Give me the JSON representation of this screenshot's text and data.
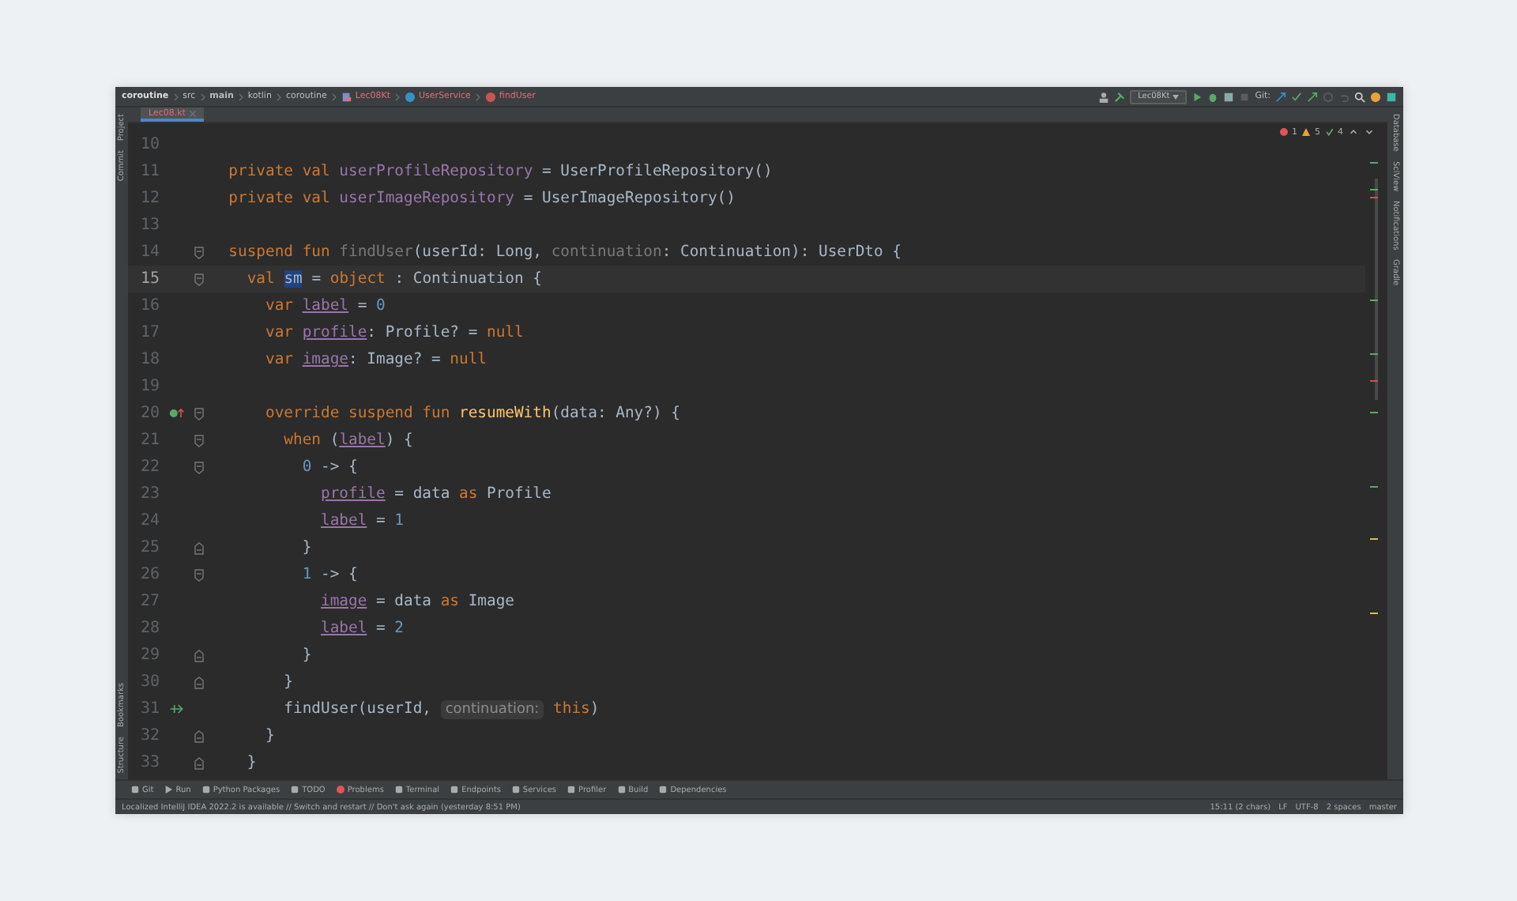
{
  "breadcrumbs": [
    {
      "label": "coroutine",
      "kind": "project"
    },
    {
      "label": "src",
      "kind": "folder"
    },
    {
      "label": "main",
      "kind": "folder"
    },
    {
      "label": "kotlin",
      "kind": "folder"
    },
    {
      "label": "coroutine",
      "kind": "folder"
    },
    {
      "label": "Lec08Kt",
      "kind": "file"
    },
    {
      "label": "UserService",
      "kind": "class"
    },
    {
      "label": "findUser",
      "kind": "method"
    }
  ],
  "toolbar": {
    "run_config": "Lec08Kt",
    "vcs_label": "Git:"
  },
  "tabs": [
    {
      "label": "Lec08.kt",
      "selected": true
    }
  ],
  "left_tools_top": [
    "Project",
    "Commit"
  ],
  "left_tools_bottom": [
    "Bookmarks",
    "Structure"
  ],
  "right_tools": [
    "Database",
    "SciView",
    "Notifications",
    "Gradle"
  ],
  "inspections": {
    "errors": "1",
    "warnings": "5",
    "weak": "4"
  },
  "lines": [
    {
      "number": "10",
      "current": false
    },
    {
      "number": "11",
      "current": false,
      "tokens": [
        {
          "kind": "keyword",
          "t": "  private val "
        },
        {
          "kind": "field",
          "t": "userProfileRepository"
        },
        {
          "kind": "plain",
          "t": " = UserProfileRepository()"
        }
      ]
    },
    {
      "number": "12",
      "current": false,
      "tokens": [
        {
          "kind": "keyword",
          "t": "  private val "
        },
        {
          "kind": "field",
          "t": "userImageRepository"
        },
        {
          "kind": "plain",
          "t": " = UserImageRepository()"
        }
      ]
    },
    {
      "number": "13",
      "current": false
    },
    {
      "number": "14",
      "current": false,
      "fold_start": true,
      "tokens": [
        {
          "kind": "keyword",
          "t": "  suspend fun "
        },
        {
          "kind": "unused",
          "t": "findUser"
        },
        {
          "kind": "plain",
          "t": "(userId: Long, "
        },
        {
          "kind": "unused",
          "t": "continuation"
        },
        {
          "kind": "plain",
          "t": ": Continuation): UserDto {"
        }
      ]
    },
    {
      "number": "15",
      "current": true,
      "fold_start": true,
      "tokens": [
        {
          "kind": "keyword",
          "t": "    val "
        },
        {
          "kind": "selection",
          "t": "sm"
        },
        {
          "kind": "plain",
          "t": " = "
        },
        {
          "kind": "keyword",
          "t": "object"
        },
        {
          "kind": "plain",
          "t": " : Continuation {"
        }
      ]
    },
    {
      "number": "16",
      "current": false,
      "tokens": [
        {
          "kind": "keyword",
          "t": "      var "
        },
        {
          "kind": "local",
          "t": "label"
        },
        {
          "kind": "plain",
          "t": " = "
        },
        {
          "kind": "number",
          "t": "0"
        }
      ]
    },
    {
      "number": "17",
      "current": false,
      "tokens": [
        {
          "kind": "keyword",
          "t": "      var "
        },
        {
          "kind": "local",
          "t": "profile"
        },
        {
          "kind": "plain",
          "t": ": Profile? = "
        },
        {
          "kind": "keyword",
          "t": "null"
        }
      ]
    },
    {
      "number": "18",
      "current": false,
      "tokens": [
        {
          "kind": "keyword",
          "t": "      var "
        },
        {
          "kind": "local",
          "t": "image"
        },
        {
          "kind": "plain",
          "t": ": Image? = "
        },
        {
          "kind": "keyword",
          "t": "null"
        }
      ]
    },
    {
      "number": "19",
      "current": false
    },
    {
      "number": "20",
      "current": false,
      "fold_start": true,
      "override_marker": true,
      "tokens": [
        {
          "kind": "keyword",
          "t": "      override suspend fun "
        },
        {
          "kind": "function",
          "t": "resumeWith"
        },
        {
          "kind": "plain",
          "t": "(data: Any?) {"
        }
      ]
    },
    {
      "number": "21",
      "current": false,
      "fold_start": true,
      "tokens": [
        {
          "kind": "keyword",
          "t": "        when "
        },
        {
          "kind": "plain",
          "t": "("
        },
        {
          "kind": "local",
          "t": "label"
        },
        {
          "kind": "plain",
          "t": ") {"
        }
      ]
    },
    {
      "number": "22",
      "current": false,
      "fold_start": true,
      "tokens": [
        {
          "kind": "number",
          "t": "          0"
        },
        {
          "kind": "plain",
          "t": " -> {"
        }
      ]
    },
    {
      "number": "23",
      "current": false,
      "tokens": [
        {
          "kind": "local",
          "t": "            profile"
        },
        {
          "kind": "plain",
          "t": " = data "
        },
        {
          "kind": "keyword",
          "t": "as"
        },
        {
          "kind": "plain",
          "t": " Profile"
        }
      ]
    },
    {
      "number": "24",
      "current": false,
      "tokens": [
        {
          "kind": "local",
          "t": "            label"
        },
        {
          "kind": "plain",
          "t": " = "
        },
        {
          "kind": "number",
          "t": "1"
        }
      ]
    },
    {
      "number": "25",
      "current": false,
      "fold_end": true,
      "tokens": [
        {
          "kind": "plain",
          "t": "          }"
        }
      ]
    },
    {
      "number": "26",
      "current": false,
      "fold_start": true,
      "tokens": [
        {
          "kind": "number",
          "t": "          1"
        },
        {
          "kind": "plain",
          "t": " -> {"
        }
      ]
    },
    {
      "number": "27",
      "current": false,
      "tokens": [
        {
          "kind": "local",
          "t": "            image"
        },
        {
          "kind": "plain",
          "t": " = data "
        },
        {
          "kind": "keyword",
          "t": "as"
        },
        {
          "kind": "plain",
          "t": " Image"
        }
      ]
    },
    {
      "number": "28",
      "current": false,
      "tokens": [
        {
          "kind": "local",
          "t": "            label"
        },
        {
          "kind": "plain",
          "t": " = "
        },
        {
          "kind": "number",
          "t": "2"
        }
      ]
    },
    {
      "number": "29",
      "current": false,
      "fold_end": true,
      "tokens": [
        {
          "kind": "plain",
          "t": "          }"
        }
      ]
    },
    {
      "number": "30",
      "current": false,
      "fold_end": true,
      "tokens": [
        {
          "kind": "plain",
          "t": "        }"
        }
      ]
    },
    {
      "number": "31",
      "current": false,
      "suspend_marker": true,
      "tokens": [
        {
          "kind": "plain",
          "t": "        findUser(userId, "
        },
        {
          "kind": "hint",
          "t": "continuation:"
        },
        {
          "kind": "keyword",
          "t": " this"
        },
        {
          "kind": "plain",
          "t": ")"
        }
      ]
    },
    {
      "number": "32",
      "current": false,
      "fold_end": true,
      "tokens": [
        {
          "kind": "plain",
          "t": "      }"
        }
      ]
    },
    {
      "number": "33",
      "current": false,
      "fold_end": true,
      "tokens": [
        {
          "kind": "plain",
          "t": "    }"
        }
      ]
    }
  ],
  "bottom_tools": [
    {
      "label": "Git",
      "kind": "git"
    },
    {
      "label": "Run",
      "kind": "run"
    },
    {
      "label": "Python Packages",
      "kind": "packages"
    },
    {
      "label": "TODO",
      "kind": "todo"
    },
    {
      "label": "Problems",
      "kind": "problems"
    },
    {
      "label": "Terminal",
      "kind": "terminal"
    },
    {
      "label": "Endpoints",
      "kind": "endpoints"
    },
    {
      "label": "Services",
      "kind": "services"
    },
    {
      "label": "Profiler",
      "kind": "profiler"
    },
    {
      "label": "Build",
      "kind": "build"
    },
    {
      "label": "Dependencies",
      "kind": "dependencies"
    }
  ],
  "status": {
    "message": "Localized IntelliJ IDEA 2022.2 is available // Switch and restart // Don't ask again (yesterday 8:51 PM)",
    "position": "15:11 (2 chars)",
    "line_separator": "LF",
    "encoding": "UTF-8",
    "indent": "2 spaces",
    "branch": "master"
  }
}
